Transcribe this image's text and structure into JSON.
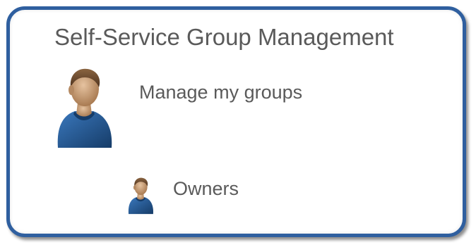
{
  "panel": {
    "title": "Self-Service Group Management"
  },
  "items": [
    {
      "label": "Manage my groups",
      "icon": "user-icon"
    },
    {
      "label": "Owners",
      "icon": "user-icon"
    }
  ],
  "colors": {
    "border": "#2f5f9f",
    "text": "#5a5a5a",
    "shirt": "#1f4f86",
    "skin": "#c9a07a",
    "hair": "#6b4a2b"
  }
}
